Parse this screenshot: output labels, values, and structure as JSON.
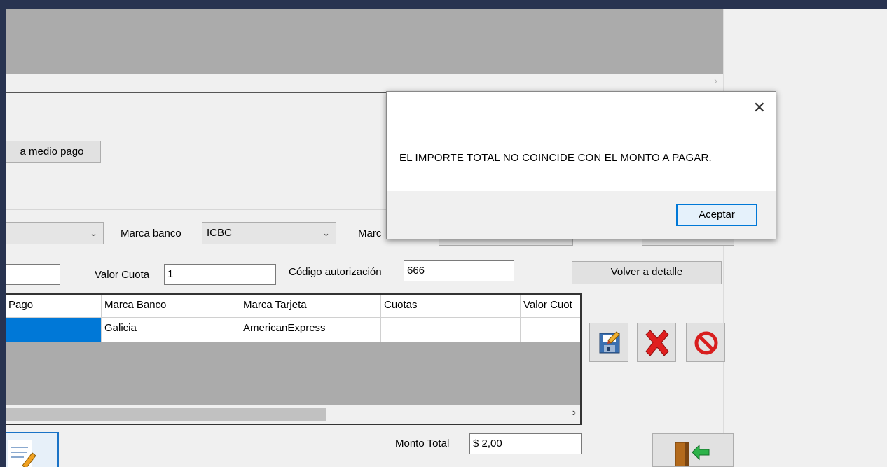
{
  "form": {
    "media_pago_button": "a medio pago",
    "marca_banco_label": "Marca banco",
    "marca_banco_value": "ICBC",
    "marca_partial_label": "Marc",
    "valor_cuota_label": "Valor Cuota",
    "valor_cuota_value": "1",
    "codigo_label": "Código autorización",
    "codigo_value": "666",
    "volver_button": "Volver a detalle",
    "monto_total_label": "Monto Total",
    "monto_total_value": "$ 2,00"
  },
  "grid": {
    "headers": [
      "Pago",
      "Marca Banco",
      "Marca Tarjeta",
      "Cuotas",
      "Valor Cuot"
    ],
    "rows": [
      [
        "",
        "Galicia",
        "AmericanExpress",
        "",
        ""
      ]
    ]
  },
  "icons": [
    "save-icon",
    "delete-x-icon",
    "cancel-icon",
    "edit-document-icon",
    "exit-door-icon"
  ],
  "dialog": {
    "message": "EL IMPORTE TOTAL NO COINCIDE CON EL MONTO A PAGAR.",
    "ok_label": "Aceptar",
    "close_glyph": "✕"
  },
  "colors": {
    "selected_cell": "#0078d7",
    "delete_red": "#e01f1f",
    "window_bg": "#f0f0f0",
    "desktop_bg": "#283350"
  }
}
